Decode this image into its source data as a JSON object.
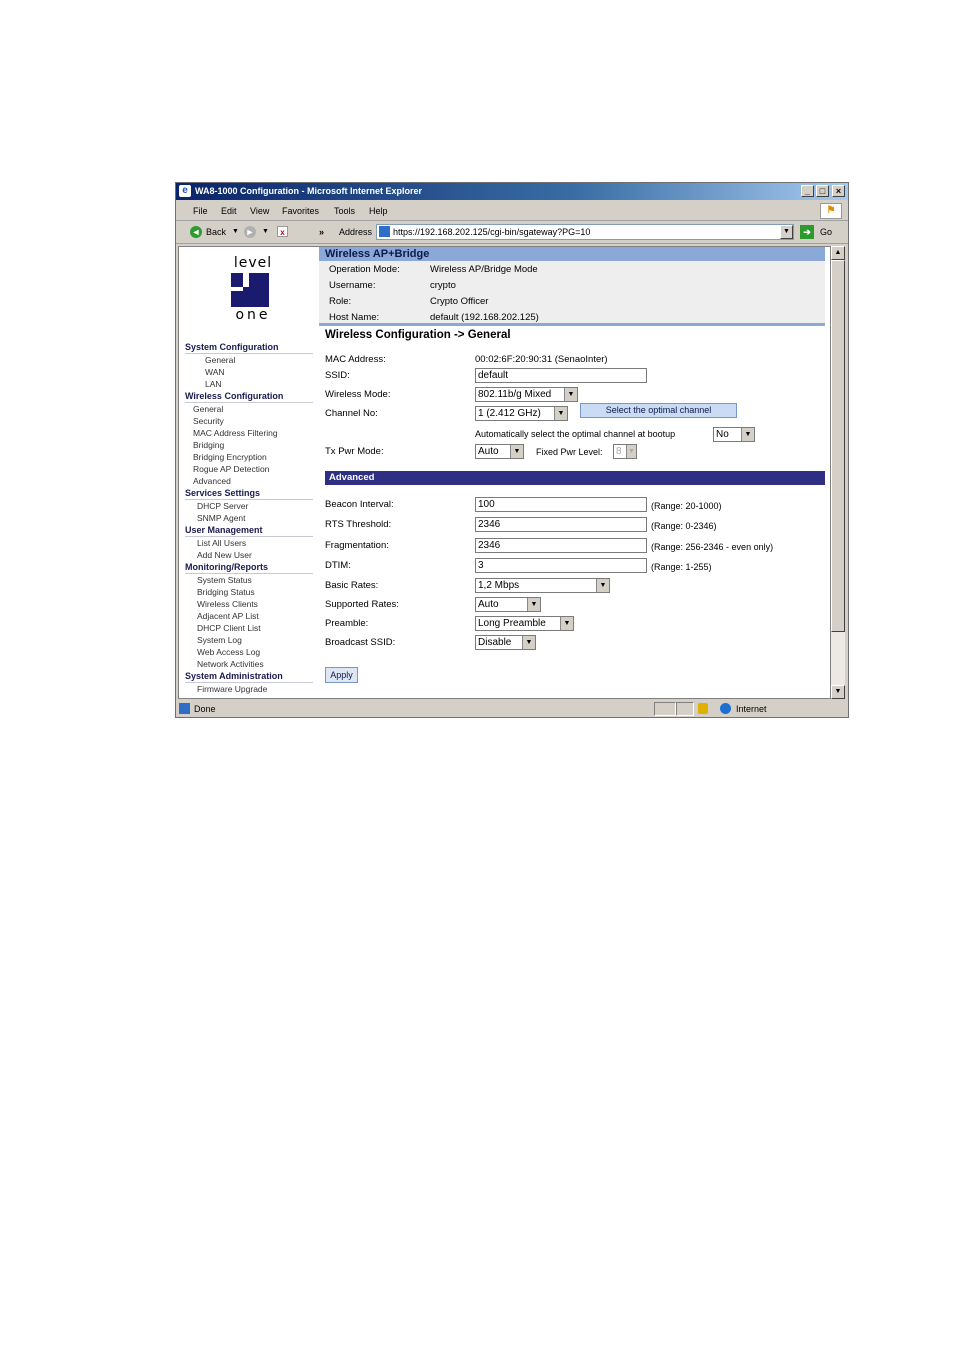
{
  "window": {
    "title": "WA8-1000 Configuration - Microsoft Internet Explorer",
    "minimize": "_",
    "maximize": "□",
    "close": "×"
  },
  "menu": [
    "File",
    "Edit",
    "View",
    "Favorites",
    "Tools",
    "Help"
  ],
  "toolbar": {
    "back": "Back",
    "chevrons": "»",
    "address_label": "Address",
    "url": "https://192.168.202.125/cgi-bin/sgateway?PG=10",
    "go": "Go"
  },
  "sidebar": {
    "logo_top": "level",
    "logo_bottom": "one",
    "sections": [
      {
        "title": "System Configuration",
        "items": [
          "General",
          "WAN",
          "LAN"
        ]
      },
      {
        "title": "Wireless Configuration",
        "items": [
          "General",
          "Security",
          "MAC Address Filtering",
          "Bridging",
          "Bridging Encryption",
          "Rogue AP Detection",
          "Advanced"
        ]
      },
      {
        "title": "Services Settings",
        "items": [
          "DHCP Server",
          "SNMP Agent"
        ]
      },
      {
        "title": "User Management",
        "items": [
          "List All Users",
          "Add New User"
        ]
      },
      {
        "title": "Monitoring/Reports",
        "items": [
          "System Status",
          "Bridging Status",
          "Wireless Clients",
          "Adjacent AP List",
          "DHCP Client List",
          "System Log",
          "Web Access Log",
          "Network Activities"
        ]
      },
      {
        "title": "System Administration",
        "items": [
          "Firmware Upgrade"
        ]
      }
    ]
  },
  "header": {
    "title": "Wireless AP+Bridge",
    "operation_mode_label": "Operation Mode:",
    "operation_mode": "Wireless AP/Bridge Mode",
    "username_label": "Username:",
    "username": "crypto",
    "role_label": "Role:",
    "role": "Crypto Officer",
    "hostname_label": "Host Name:",
    "hostname": "default (192.168.202.125)"
  },
  "general": {
    "title": "Wireless Configuration -> General",
    "mac_label": "MAC Address:",
    "mac": "00:02:6F:20:90:31 (SenaoInter)",
    "ssid_label": "SSID:",
    "ssid": "default",
    "mode_label": "Wireless Mode:",
    "mode": "802.11b/g Mixed",
    "channel_label": "Channel No:",
    "channel": "1 (2.412 GHz)",
    "optimal_button": "Select the optimal channel",
    "auto_label": "Automatically select the optimal channel at bootup",
    "auto_value": "No",
    "txpwr_label": "Tx Pwr Mode:",
    "txpwr": "Auto",
    "fixed_label": "Fixed Pwr Level:",
    "fixed_value": "8"
  },
  "advanced": {
    "title": "Advanced",
    "beacon_label": "Beacon Interval:",
    "beacon": "100",
    "beacon_range": "(Range: 20-1000)",
    "rts_label": "RTS Threshold:",
    "rts": "2346",
    "rts_range": "(Range: 0-2346)",
    "frag_label": "Fragmentation:",
    "frag": "2346",
    "frag_range": "(Range: 256-2346 - even only)",
    "dtim_label": "DTIM:",
    "dtim": "3",
    "dtim_range": "(Range: 1-255)",
    "basic_rates_label": "Basic Rates:",
    "basic_rates": "1,2 Mbps",
    "supported_rates_label": "Supported Rates:",
    "supported_rates": "Auto",
    "preamble_label": "Preamble:",
    "preamble": "Long Preamble",
    "broadcast_label": "Broadcast SSID:",
    "broadcast": "Disable",
    "apply": "Apply"
  },
  "status": {
    "text": "Done",
    "zone": "Internet"
  }
}
